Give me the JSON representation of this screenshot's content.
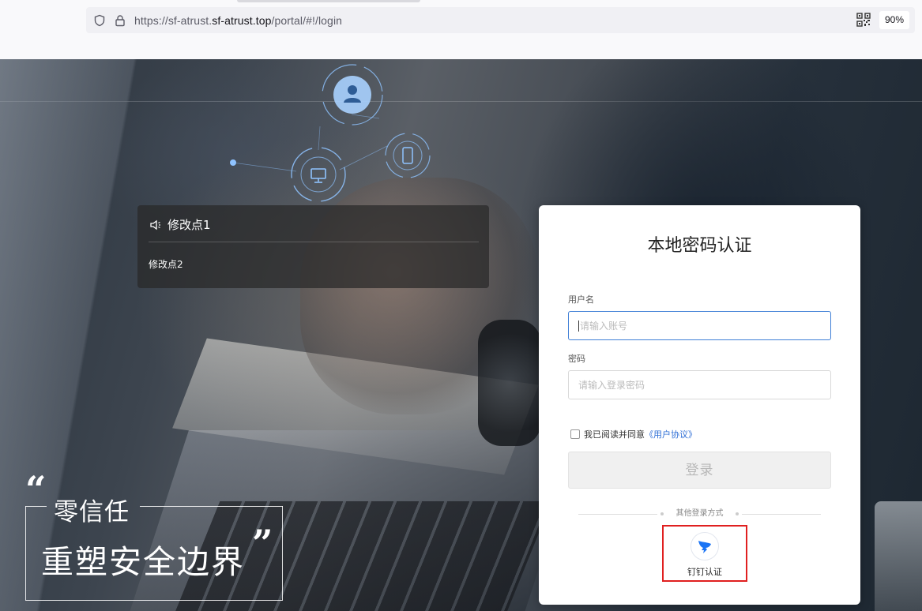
{
  "browser": {
    "url_prefix": "https://sf-atrust.",
    "url_domain": "sf-atrust.top",
    "url_path": "/portal/#!/login",
    "zoom": "90%"
  },
  "notice": {
    "title": "修改点1",
    "body": "修改点2"
  },
  "slogan": {
    "line1": "零信任",
    "line2": "重塑安全边界",
    "quote_open": "“",
    "quote_close": "”"
  },
  "login": {
    "title": "本地密码认证",
    "username_label": "用户名",
    "username_placeholder": "请输入账号",
    "password_label": "密码",
    "password_placeholder": "请输入登录密码",
    "agree_text": "我已阅读并同意",
    "agree_link": "《用户协议》",
    "submit_label": "登录",
    "other_methods": "其他登录方式",
    "dingtalk_label": "钉钉认证"
  },
  "colors": {
    "accent": "#2f6fd6",
    "highlight_border": "#e02020",
    "network_icon": "#8fc3ff"
  },
  "icons": {
    "shield": "shield-icon",
    "lock": "lock-icon",
    "qr": "qr-code-icon",
    "speaker": "speaker-icon",
    "dingtalk": "dingtalk-icon",
    "user_node": "user-icon",
    "desktop_node": "desktop-icon",
    "mobile_node": "mobile-icon"
  }
}
